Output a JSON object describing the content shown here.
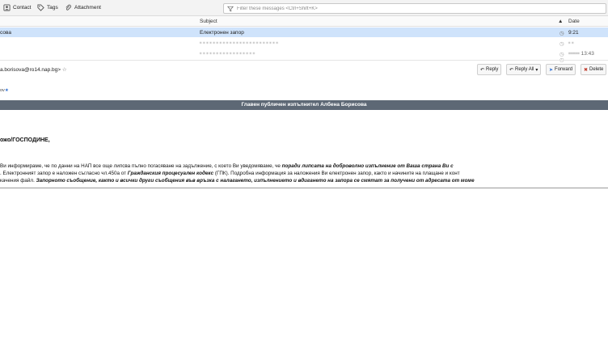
{
  "toolbar": {
    "contact_label": "Contact",
    "tags_label": "Tags",
    "attachment_label": "Attachment",
    "search_placeholder": "Filter these messages <Ctrl+Shift+K>"
  },
  "list": {
    "columns": {
      "subject": "Subject",
      "date": "Date"
    },
    "rows": [
      {
        "sender": "сова",
        "subject": "Електронен запор",
        "date": "9:21"
      },
      {
        "sender": "",
        "subject": "",
        "date": ""
      },
      {
        "sender": "",
        "subject": "",
        "date": "13:43"
      },
      {
        "sender": "",
        "subject": "",
        "date": ""
      }
    ]
  },
  "message": {
    "from": "a.borisova@ro14.nap.bg>",
    "to_fragment": "ov",
    "actions": {
      "reply": "Reply",
      "reply_all": "Reply All",
      "forward": "Forward",
      "delete": "Delete"
    },
    "banner": "Главен публичен изпълнител Албена Борисова",
    "greeting": "ожо/ГОСПОДИНЕ,",
    "body": {
      "l1_a": "Ви информираме, че по данни на НАП все още липсва пълно погасяване на задължение, с което Ви уведомяваме, че ",
      "l1_b": "поради липсата на доброволно изпълнение от Ваша страна Ви с",
      "l2_a": ". Електронният запор е наложен съгласно чл.450а от ",
      "l2_b": "Гражданския процесуален кодекс",
      "l2_c": " (ГПК). Подробна информация за наложения Ви електронен запор, както и начините на плащане и конт",
      "l3_a": "качения файл. ",
      "l3_b": "Запорното съобщение, както и всички други съобщения във връзка с налагането, изпълнението и вдигането на запора се смятат за получени от адресата от моме"
    }
  },
  "colors": {
    "selected_row": "#cfe3fb",
    "banner_bg": "#5d6875",
    "accent_blue": "#2f6fd1"
  }
}
